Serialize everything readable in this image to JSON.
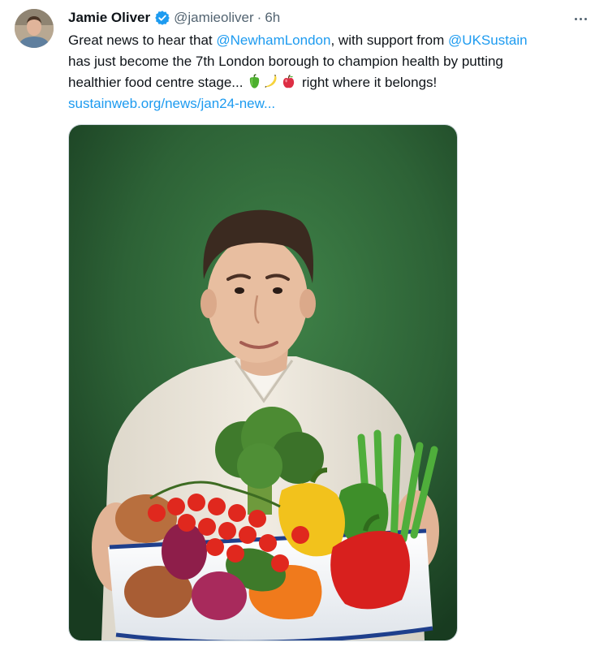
{
  "tweet": {
    "author_name": "Jamie Oliver",
    "handle": "@jamieoliver",
    "separator": "·",
    "time": "6h",
    "text": {
      "l1_pre": "Great news to hear that ",
      "l1_mention1": "@NewhamLondon",
      "l1_mid": ", with support from ",
      "l1_mention2": "@UKSustain",
      "l2": "has just become the 7th London borough to champion health by putting",
      "l3_pre": "healthier food centre stage...",
      "l3_post": "right where it belongs!",
      "link": "sustainweb.org/news/jan24-new..."
    },
    "emojis": [
      "bell-pepper-emoji",
      "banana-emoji",
      "apple-emoji"
    ],
    "icons": {
      "verified": "verified-badge-icon",
      "more": "more-options-icon"
    },
    "colors": {
      "link": "#1d9bf0",
      "verified": "#1d9bf0",
      "secondary_text": "#536471",
      "photo_background": "#2f6a3a"
    }
  }
}
